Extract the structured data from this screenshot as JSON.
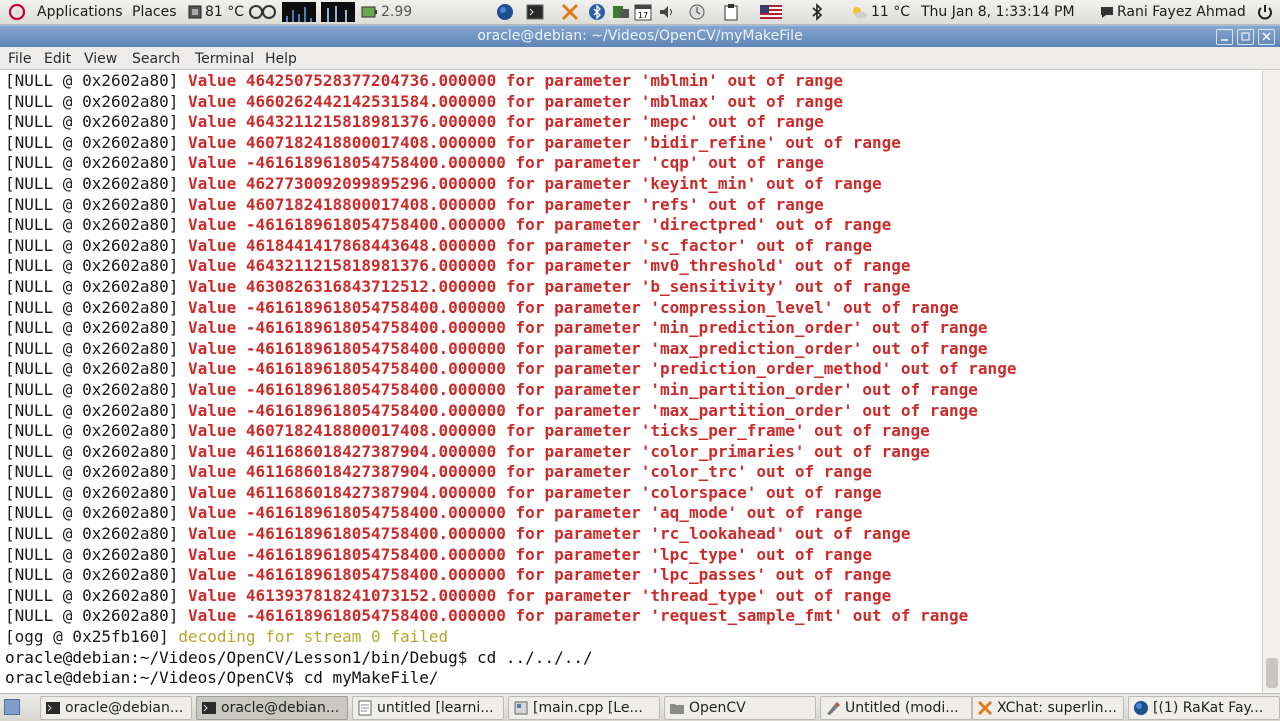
{
  "top_panel": {
    "applications_label": "Applications",
    "places_label": "Places",
    "cpu_temp": "81 °C",
    "cpu_freq": "2.99",
    "weather_temp": "11 °C",
    "clock": "Thu Jan  8,  1:33:14 PM",
    "user_name": "Rani Fayez Ahmad"
  },
  "window": {
    "title": "oracle@debian: ~/Videos/OpenCV/myMakeFile"
  },
  "menubar": {
    "items": [
      "File",
      "Edit",
      "View",
      "Search",
      "Terminal",
      "Help"
    ]
  },
  "terminal": {
    "prefix": "[NULL @ 0x2602a80] ",
    "error_lines": [
      "Value 4642507528377204736.000000 for parameter 'mblmin' out of range",
      "Value 4660262442142531584.000000 for parameter 'mblmax' out of range",
      "Value 4643211215818981376.000000 for parameter 'mepc' out of range",
      "Value 4607182418800017408.000000 for parameter 'bidir_refine' out of range",
      "Value -4616189618054758400.000000 for parameter 'cqp' out of range",
      "Value 4627730092099895296.000000 for parameter 'keyint_min' out of range",
      "Value 4607182418800017408.000000 for parameter 'refs' out of range",
      "Value -4616189618054758400.000000 for parameter 'directpred' out of range",
      "Value 4618441417868443648.000000 for parameter 'sc_factor' out of range",
      "Value 4643211215818981376.000000 for parameter 'mv0_threshold' out of range",
      "Value 4630826316843712512.000000 for parameter 'b_sensitivity' out of range",
      "Value -4616189618054758400.000000 for parameter 'compression_level' out of range",
      "Value -4616189618054758400.000000 for parameter 'min_prediction_order' out of range",
      "Value -4616189618054758400.000000 for parameter 'max_prediction_order' out of range",
      "Value -4616189618054758400.000000 for parameter 'prediction_order_method' out of range",
      "Value -4616189618054758400.000000 for parameter 'min_partition_order' out of range",
      "Value -4616189618054758400.000000 for parameter 'max_partition_order' out of range",
      "Value 4607182418800017408.000000 for parameter 'ticks_per_frame' out of range",
      "Value 4611686018427387904.000000 for parameter 'color_primaries' out of range",
      "Value 4611686018427387904.000000 for parameter 'color_trc' out of range",
      "Value 4611686018427387904.000000 for parameter 'colorspace' out of range",
      "Value -4616189618054758400.000000 for parameter 'aq_mode' out of range",
      "Value -4616189618054758400.000000 for parameter 'rc_lookahead' out of range",
      "Value -4616189618054758400.000000 for parameter 'lpc_type' out of range",
      "Value -4616189618054758400.000000 for parameter 'lpc_passes' out of range",
      "Value 4613937818241073152.000000 for parameter 'thread_type' out of range",
      "Value -4616189618054758400.000000 for parameter 'request_sample_fmt' out of range"
    ],
    "ogg_prefix": "[ogg @ 0x25fb160] ",
    "ogg_message": "decoding for stream 0 failed",
    "prompt_lines": [
      "oracle@debian:~/Videos/OpenCV/Lesson1/bin/Debug$ cd ../../../",
      "oracle@debian:~/Videos/OpenCV$ cd myMakeFile/"
    ]
  },
  "taskbar": {
    "items": [
      {
        "label": "oracle@debian...",
        "icon": "terminal-icon",
        "active": false
      },
      {
        "label": "oracle@debian...",
        "icon": "terminal-icon",
        "active": true
      },
      {
        "label": "untitled [learni...",
        "icon": "text-editor-icon",
        "active": false
      },
      {
        "label": "[main.cpp [Le...",
        "icon": "code-editor-icon",
        "active": false
      },
      {
        "label": "OpenCV",
        "icon": "folder-icon",
        "active": false
      },
      {
        "label": "Untitled (modi...",
        "icon": "drawing-icon",
        "active": false
      },
      {
        "label": "XChat: superlin...",
        "icon": "xchat-icon",
        "active": false
      },
      {
        "label": "[(1) RaKat Fay...",
        "icon": "browser-icon",
        "active": false
      }
    ]
  }
}
